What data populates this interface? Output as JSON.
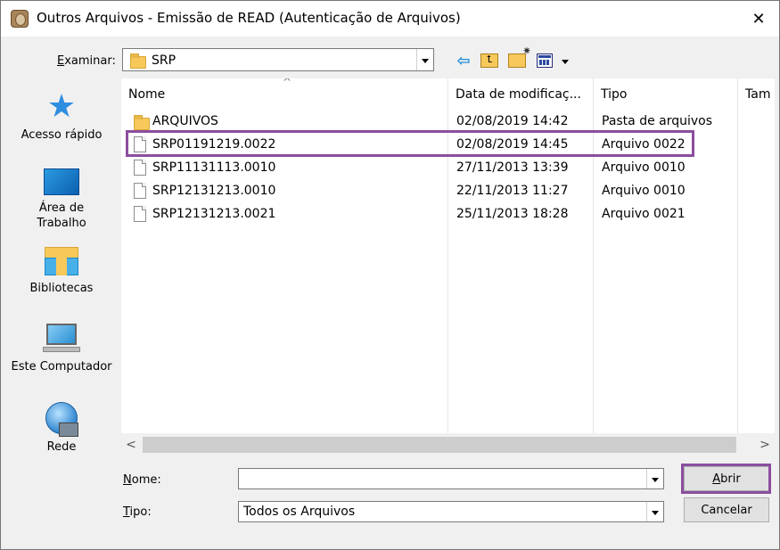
{
  "window": {
    "title": "Outros Arquivos - Emissão de READ (Autenticação de Arquivos)",
    "icon": "app-icon",
    "close_glyph": "✕"
  },
  "lookin": {
    "label_accel": "E",
    "label_rest": "xaminar:",
    "value": "SRP"
  },
  "toolbar": {
    "back_glyph": "⇦",
    "up_glyph": "⮤"
  },
  "places": [
    {
      "label": "Acesso rápido",
      "icon": "star-icon"
    },
    {
      "label_line1": "Área de",
      "label_line2": "Trabalho",
      "icon": "desktop-icon"
    },
    {
      "label": "Bibliotecas",
      "icon": "libraries-icon"
    },
    {
      "label": "Este Computador",
      "icon": "computer-icon"
    },
    {
      "label": "Rede",
      "icon": "network-icon"
    }
  ],
  "columns": {
    "name": "Nome",
    "modified": "Data de modificaç...",
    "type": "Tipo",
    "size": "Tam"
  },
  "files": [
    {
      "name": "ARQUIVOS",
      "modified": "02/08/2019 14:42",
      "type": "Pasta de arquivos",
      "kind": "folder"
    },
    {
      "name": "SRP01191219.0022",
      "modified": "02/08/2019 14:45",
      "type": "Arquivo 0022",
      "kind": "file"
    },
    {
      "name": "SRP11131113.0010",
      "modified": "27/11/2013 13:39",
      "type": "Arquivo 0010",
      "kind": "file"
    },
    {
      "name": "SRP12131213.0010",
      "modified": "22/11/2013 11:27",
      "type": "Arquivo 0010",
      "kind": "file"
    },
    {
      "name": "SRP12131213.0021",
      "modified": "25/11/2013 18:28",
      "type": "Arquivo 0021",
      "kind": "file"
    }
  ],
  "scroll": {
    "left_glyph": "<",
    "right_glyph": ">"
  },
  "fields": {
    "name_label_accel": "N",
    "name_label_rest": "ome:",
    "name_value": "",
    "type_label_accel": "T",
    "type_label_rest": "ipo:",
    "type_value": "Todos os Arquivos"
  },
  "buttons": {
    "open_accel": "A",
    "open_rest": "brir",
    "cancel": "Cancelar"
  },
  "colors": {
    "highlight": "#8b4e9e",
    "folder": "#f7c95a",
    "accent": "#2f8ee0"
  }
}
